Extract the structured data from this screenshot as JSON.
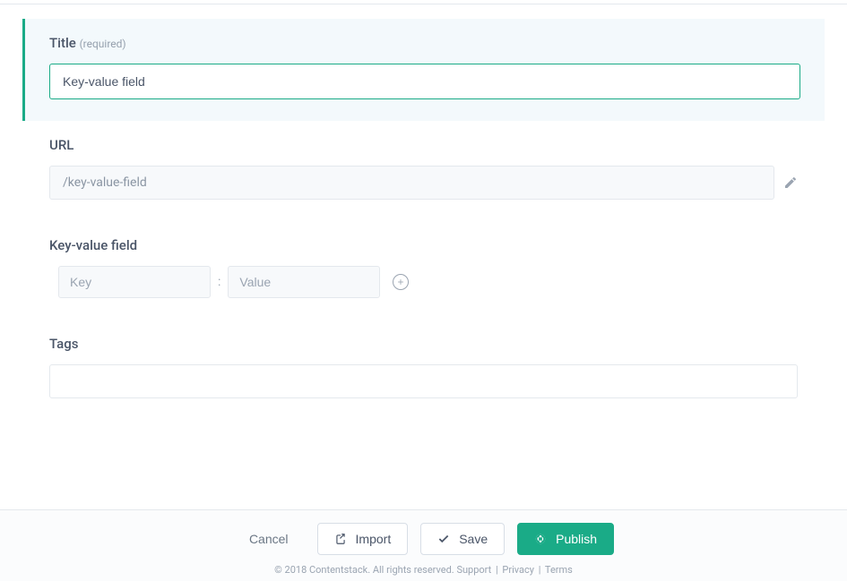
{
  "title_field": {
    "label": "Title",
    "required_text": "(required)",
    "value": "Key-value field"
  },
  "url_field": {
    "label": "URL",
    "value": "/key-value-field"
  },
  "kv_field": {
    "label": "Key-value field",
    "key_placeholder": "Key",
    "value_placeholder": "Value",
    "separator": ":"
  },
  "tags_field": {
    "label": "Tags"
  },
  "footer": {
    "cancel": "Cancel",
    "import": "Import",
    "save": "Save",
    "publish": "Publish",
    "copyright": "© 2018 Contentstack. All rights reserved.",
    "support": "Support",
    "privacy": "Privacy",
    "terms": "Terms",
    "sep": "|"
  }
}
